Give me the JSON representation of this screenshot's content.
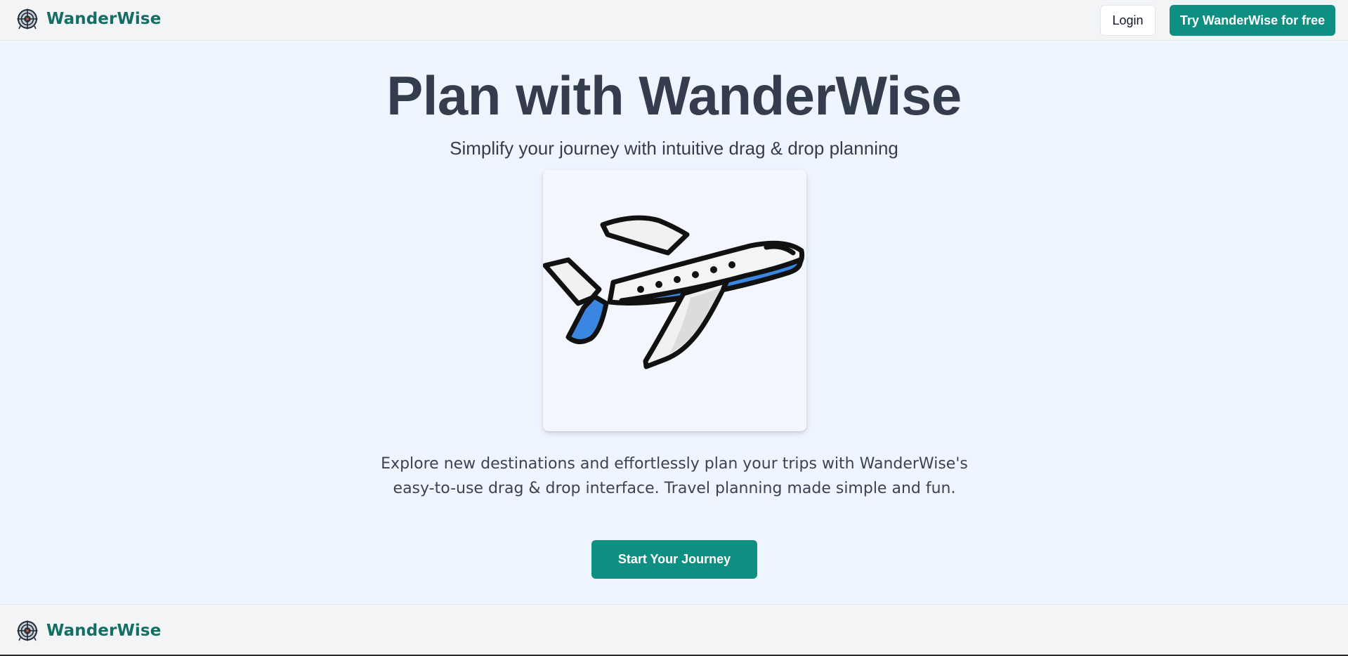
{
  "header": {
    "brand_name": "WanderWise",
    "login_label": "Login",
    "cta_label": "Try WanderWise for free"
  },
  "hero": {
    "title": "Plan with WanderWise",
    "subtitle": "Simplify your journey with intuitive drag & drop planning",
    "illustration_icon": "airplane-icon",
    "description": "Explore new destinations and effortlessly plan your trips with WanderWise's easy-to-use drag & drop interface. Travel planning made simple and fun.",
    "button_label": "Start Your Journey"
  },
  "footer": {
    "brand_name": "WanderWise"
  },
  "colors": {
    "brand": "#136f66",
    "accent": "#0e8f82",
    "heading": "#333d4e",
    "page_background": "#eff5ff",
    "bar_background": "#f3f4f6",
    "plane_blue": "#3b86e0"
  },
  "icons": {
    "logo": "compass-globe-icon"
  }
}
